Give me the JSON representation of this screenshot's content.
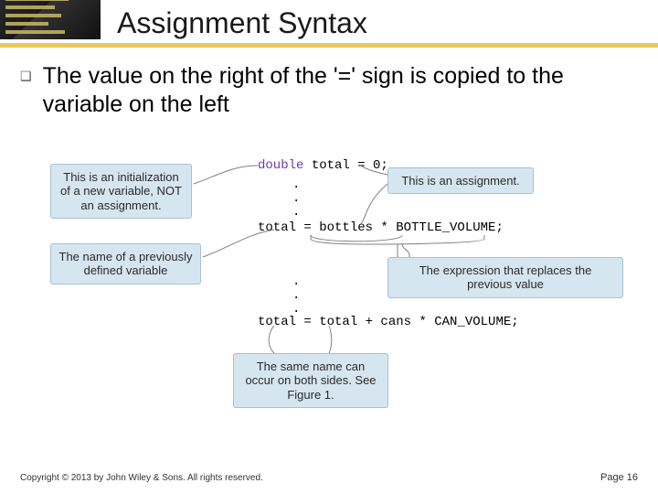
{
  "title": "Assignment Syntax",
  "bullet": "The value on the right of the '=' sign is copied to the variable on the left",
  "code": {
    "decl_keyword": "double",
    "decl_rest": " total = 0;",
    "line2": "total = bottles * BOTTLE_VOLUME;",
    "line3": "total = total + cans * CAN_VOLUME;"
  },
  "callouts": {
    "init": "This is an initialization of a new variable, NOT an assignment.",
    "assign": "This is an assignment.",
    "prev_var": "The name of a previously defined variable",
    "expr": "The expression that replaces the previous value",
    "same_name": "The same name can occur on both sides. See Figure 1."
  },
  "footer": {
    "copyright": "Copyright © 2013 by John Wiley & Sons.  All rights reserved.",
    "page": "Page 16"
  }
}
